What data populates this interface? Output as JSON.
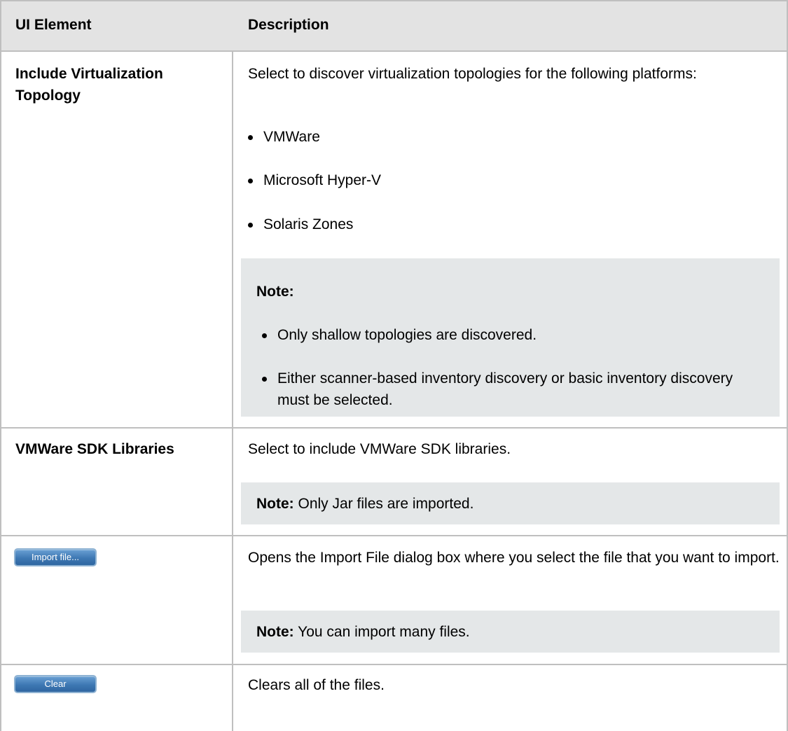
{
  "table": {
    "header": {
      "col1": "UI Element",
      "col2": "Description"
    },
    "rows": [
      {
        "element": "Include Virtualization Topology",
        "description": "Select to discover virtualization topologies for the following platforms:",
        "bullets": [
          "VMWare",
          "Microsoft Hyper-V",
          "Solaris Zones"
        ],
        "note": {
          "label": "Note:",
          "bullets": [
            "Only shallow topologies are discovered.",
            "Either scanner-based inventory discovery or basic inventory discovery must be selected."
          ]
        }
      },
      {
        "element": "VMWare SDK Libraries",
        "description": "Select to include VMWare SDK libraries.",
        "note": {
          "label": "Note:",
          "text": " Only Jar files are imported."
        }
      },
      {
        "element_button": "Import file...",
        "description": "Opens the Import File dialog box where you select the file that you want to import.",
        "note": {
          "label": "Note:",
          "text": " You can import many files."
        }
      },
      {
        "element_button": "Clear",
        "description": "Clears all of the files."
      }
    ]
  }
}
